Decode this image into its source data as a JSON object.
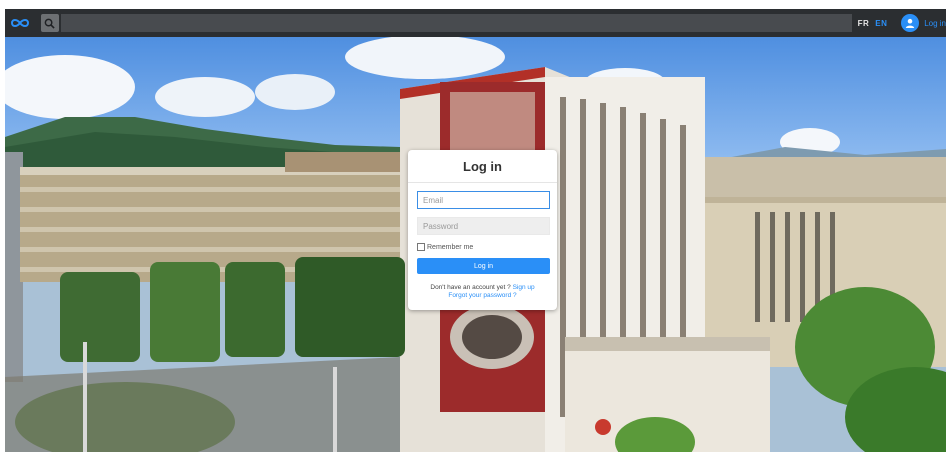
{
  "topbar": {
    "logo_icon": "infinity-icon",
    "search_icon": "search-icon",
    "search_placeholder": "",
    "lang_fr": "FR",
    "lang_en": "EN",
    "user_icon": "user-icon",
    "login_label": "Log in"
  },
  "login_card": {
    "title": "Log in",
    "email_placeholder": "Email",
    "password_placeholder": "Password",
    "remember_label": "Remember me",
    "submit_label": "Log in",
    "no_account_text": "Don't have an account yet ?",
    "signup_label": "Sign up",
    "forgot_label": "Forgot your password ?"
  },
  "colors": {
    "accent": "#2a8ff7",
    "topbar": "#2b2e31"
  }
}
